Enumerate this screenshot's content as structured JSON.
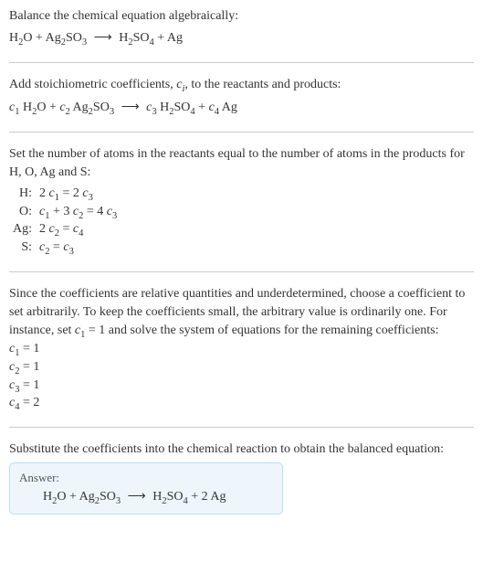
{
  "section1": {
    "intro": "Balance the chemical equation algebraically:",
    "eq_lhs1": "H",
    "eq_lhs1_sub": "2",
    "eq_lhs1b": "O + Ag",
    "eq_lhs1b_sub": "2",
    "eq_lhs1c": "SO",
    "eq_lhs1c_sub": "3",
    "arrow": "⟶",
    "eq_rhs1": "H",
    "eq_rhs1_sub": "2",
    "eq_rhs1b": "SO",
    "eq_rhs1b_sub": "4",
    "eq_rhs1c": " + Ag"
  },
  "section2": {
    "intro_a": "Add stoichiometric coefficients, ",
    "ci": "c",
    "ci_sub": "i",
    "intro_b": ", to the reactants and products:",
    "c1": "c",
    "c1_sub": "1",
    "sp1": " H",
    "sp1_sub": "2",
    "sp1b": "O + ",
    "c2": "c",
    "c2_sub": "2",
    "sp2": " Ag",
    "sp2_sub": "2",
    "sp2b": "SO",
    "sp2b_sub": "3",
    "arrow": "⟶",
    "c3": "c",
    "c3_sub": "3",
    "sp3": " H",
    "sp3_sub": "2",
    "sp3b": "SO",
    "sp3b_sub": "4",
    "plus": " + ",
    "c4": "c",
    "c4_sub": "4",
    "sp4": " Ag"
  },
  "section3": {
    "intro": "Set the number of atoms in the reactants equal to the number of atoms in the products for H, O, Ag and S:",
    "rows": [
      {
        "el": "H:",
        "lhs_a": "2 ",
        "c_a": "c",
        "s_a": "1",
        "eq": " = 2 ",
        "c_b": "c",
        "s_b": "3",
        "tail": ""
      },
      {
        "el": "O:",
        "lhs_a": "",
        "c_a": "c",
        "s_a": "1",
        "eq": " + 3 ",
        "c_b": "c",
        "s_b": "2",
        "tail_pre": " = 4 ",
        "c_c": "c",
        "s_c": "3"
      },
      {
        "el": "Ag:",
        "lhs_a": "2 ",
        "c_a": "c",
        "s_a": "2",
        "eq": " = ",
        "c_b": "c",
        "s_b": "4",
        "tail": ""
      },
      {
        "el": "S:",
        "lhs_a": "",
        "c_a": "c",
        "s_a": "2",
        "eq": " = ",
        "c_b": "c",
        "s_b": "3",
        "tail": ""
      }
    ]
  },
  "section4": {
    "intro_a": "Since the coefficients are relative quantities and underdetermined, choose a coefficient to set arbitrarily. To keep the coefficients small, the arbitrary value is ordinarily one. For instance, set ",
    "c1": "c",
    "c1_sub": "1",
    "intro_b": " = 1 and solve the system of equations for the remaining coefficients:",
    "lines": [
      {
        "c": "c",
        "s": "1",
        "v": " = 1"
      },
      {
        "c": "c",
        "s": "2",
        "v": " = 1"
      },
      {
        "c": "c",
        "s": "3",
        "v": " = 1"
      },
      {
        "c": "c",
        "s": "4",
        "v": " = 2"
      }
    ]
  },
  "section5": {
    "intro": "Substitute the coefficients into the chemical reaction to obtain the balanced equation:",
    "answer_label": "Answer:",
    "eq_a": "H",
    "eq_a_sub": "2",
    "eq_b": "O + Ag",
    "eq_b_sub": "2",
    "eq_c": "SO",
    "eq_c_sub": "3",
    "arrow": "⟶",
    "eq_d": "H",
    "eq_d_sub": "2",
    "eq_e": "SO",
    "eq_e_sub": "4",
    "eq_f": " + 2 Ag"
  }
}
